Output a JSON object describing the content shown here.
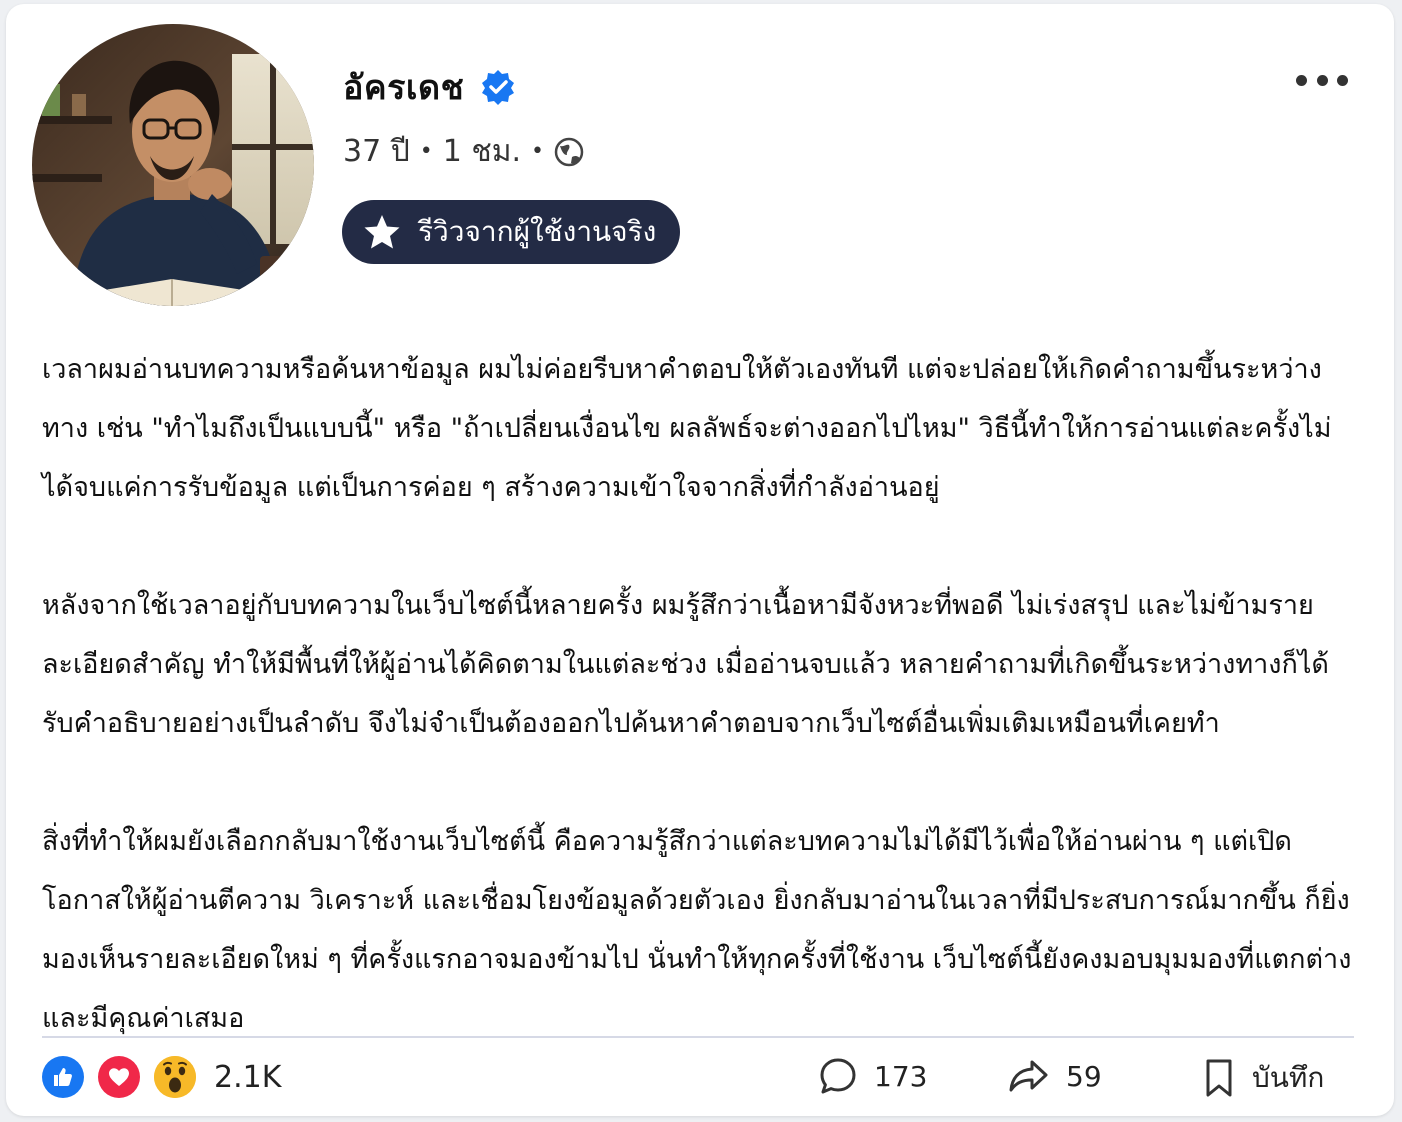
{
  "author": {
    "name": "อัครเดช",
    "verified": true,
    "age": "37 ปี",
    "time": "1 ชม.",
    "audience_icon": "globe-icon",
    "badge_label": "รีวิวจากผู้ใช้งานจริง"
  },
  "post": {
    "paragraphs": [
      "เวลาผมอ่านบทความหรือค้นหาข้อมูล ผมไม่ค่อยรีบหาคำตอบให้ตัวเองทันที แต่จะปล่อยให้เกิดคำถามขึ้นระหว่างทาง เช่น \"ทำไมถึงเป็นแบบนี้\" หรือ \"ถ้าเปลี่ยนเงื่อนไข ผลลัพธ์จะต่างออกไปไหม\" วิธีนี้ทำให้การอ่านแต่ละครั้งไม่ได้จบแค่การรับข้อมูล แต่เป็นการค่อย ๆ สร้างความเข้าใจจากสิ่งที่กำลังอ่านอยู่",
      "หลังจากใช้เวลาอยู่กับบทความในเว็บไซต์นี้หลายครั้ง ผมรู้สึกว่าเนื้อหามีจังหวะที่พอดี ไม่เร่งสรุป และไม่ข้ามรายละเอียดสำคัญ ทำให้มีพื้นที่ให้ผู้อ่านได้คิดตามในแต่ละช่วง เมื่ออ่านจบแล้ว หลายคำถามที่เกิดขึ้นระหว่างทางก็ได้รับคำอธิบายอย่างเป็นลำดับ จึงไม่จำเป็นต้องออกไปค้นหาคำตอบจากเว็บไซต์อื่นเพิ่มเติมเหมือนที่เคยทำ",
      "สิ่งที่ทำให้ผมยังเลือกกลับมาใช้งานเว็บไซต์นี้ คือความรู้สึกว่าแต่ละบทความไม่ได้มีไว้เพื่อให้อ่านผ่าน ๆ แต่เปิดโอกาสให้ผู้อ่านตีความ วิเคราะห์ และเชื่อมโยงข้อมูลด้วยตัวเอง ยิ่งกลับมาอ่านในเวลาที่มีประสบการณ์มากขึ้น ก็ยิ่งมองเห็นรายละเอียดใหม่ ๆ ที่ครั้งแรกอาจมองข้ามไป นั่นทำให้ทุกครั้งที่ใช้งาน เว็บไซต์นี้ยังคงมอบมุมมองที่แตกต่างและมีคุณค่าเสมอ"
    ]
  },
  "footer": {
    "reactions": [
      "like-icon",
      "love-icon",
      "wow-icon"
    ],
    "reaction_count": "2.1K",
    "comments": "173",
    "shares": "59",
    "save_label": "บันทึก"
  },
  "colors": {
    "badge_bg": "#232b45",
    "verified_blue": "#1877f2",
    "like_blue": "#1877f2",
    "love_red": "#f02849",
    "wow_yellow": "#f7b928"
  }
}
